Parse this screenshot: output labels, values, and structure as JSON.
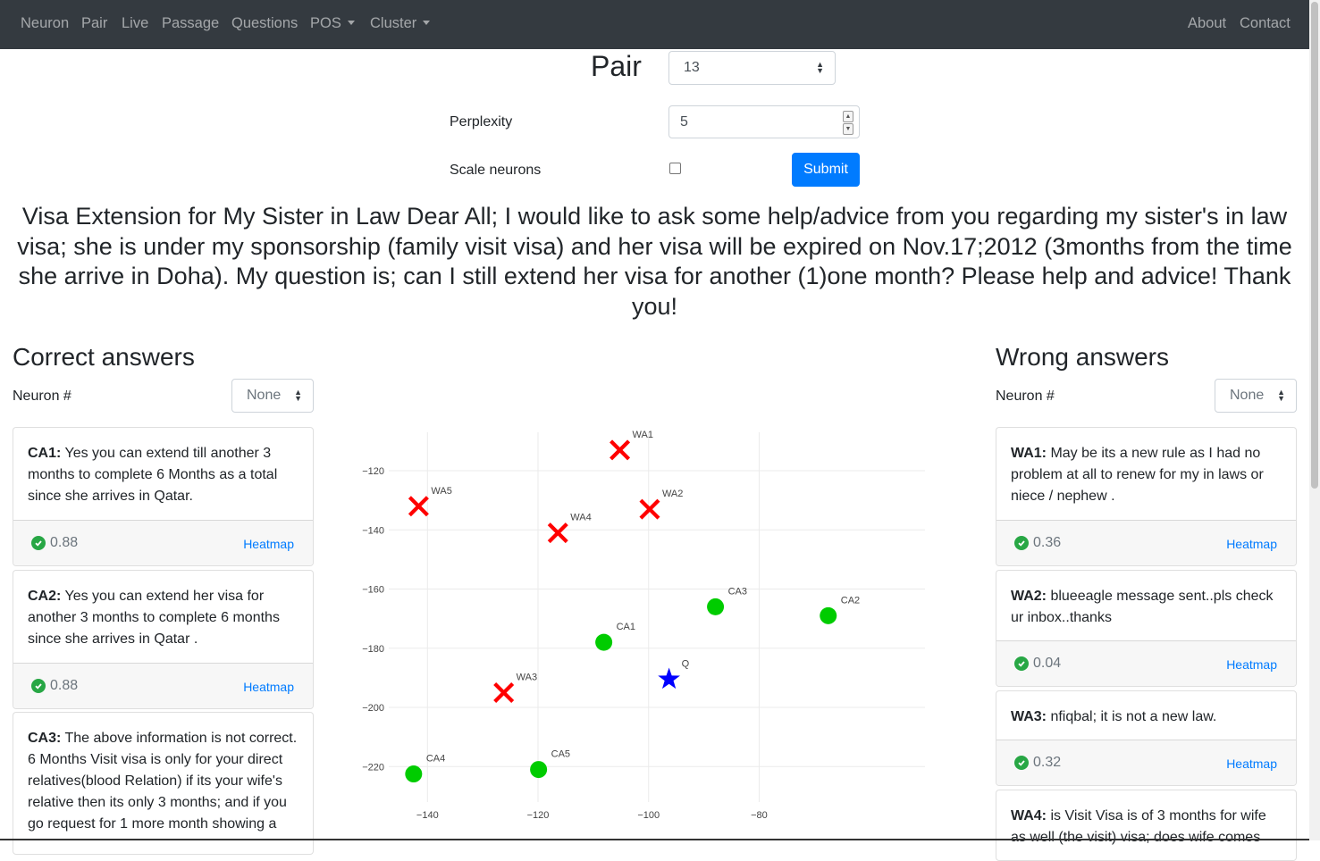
{
  "navbar": {
    "left_items": [
      {
        "label": "Neuron"
      },
      {
        "label": "Pair"
      },
      {
        "label": "Live"
      },
      {
        "label": "Passage"
      },
      {
        "label": "Questions"
      },
      {
        "label": "POS"
      },
      {
        "label": "Cluster"
      }
    ],
    "right_items": [
      {
        "label": "About"
      },
      {
        "label": "Contact"
      }
    ]
  },
  "form": {
    "pair_title": "Pair",
    "pair_value": "13",
    "perplexity_label": "Perplexity",
    "perplexity_value": "5",
    "scale_label": "Scale neurons",
    "scale_checked": false,
    "submit_label": "Submit"
  },
  "question_text": "Visa Extension for My Sister in Law Dear All; I would like to ask some help/advice from you regarding my sister's in law visa; she is under my sponsorship (family visit visa) and her visa will be expired on Nov.17;2012 (3months from the time she arrive in Doha). My question is; can I still extend her visa for another (1)one month? Please help and advice! Thank you!",
  "correct": {
    "title": "Correct answers",
    "neuron_label": "Neuron #",
    "neuron_value": "None",
    "cards": [
      {
        "id": "CA1:",
        "text": "Yes you can extend till another 3 months to complete 6 Months as a total since she arrives in Qatar.",
        "score": "0.88",
        "link": "Heatmap"
      },
      {
        "id": "CA2:",
        "text": "Yes you can extend her visa for another 3 months to complete 6 months since she arrives in Qatar .",
        "score": "0.88",
        "link": "Heatmap"
      },
      {
        "id": "CA3:",
        "text": "The above information is not correct. 6 Months Visit visa is only for your direct relatives(blood Relation) if its your wife's relative then its only 3 months; and if you go request for 1 more month showing a",
        "score": "",
        "link": ""
      }
    ]
  },
  "wrong": {
    "title": "Wrong answers",
    "neuron_label": "Neuron #",
    "neuron_value": "None",
    "cards": [
      {
        "id": "WA1:",
        "text": "May be its a new rule as I had no problem at all to renew for my in laws or niece / nephew .",
        "score": "0.36",
        "link": "Heatmap"
      },
      {
        "id": "WA2:",
        "text": "blueeagle message sent..pls check ur inbox..thanks",
        "score": "0.04",
        "link": "Heatmap"
      },
      {
        "id": "WA3:",
        "text": "nfiqbal; it is not a new law.",
        "score": "0.32",
        "link": "Heatmap"
      },
      {
        "id": "WA4:",
        "text": "is Visit Visa is of 3 months for wife as well (the visit) visa; does wife comes",
        "score": "",
        "link": ""
      }
    ]
  },
  "chart_data": {
    "type": "scatter",
    "xlim": [
      -147,
      -50
    ],
    "ylim": [
      -232,
      -107
    ],
    "x_ticks": [
      -140,
      -120,
      -100,
      -80
    ],
    "y_ticks": [
      -120,
      -140,
      -160,
      -180,
      -200,
      -220
    ],
    "grid": true,
    "series": [
      {
        "name": "",
        "marker": "circle",
        "color": "#00cc00",
        "points": [
          {
            "label": "CA1",
            "x": -108.1,
            "y": -178.0
          },
          {
            "label": "CA2",
            "x": -67.5,
            "y": -169.0
          },
          {
            "label": "CA3",
            "x": -87.9,
            "y": -166.0
          },
          {
            "label": "CA4",
            "x": -142.5,
            "y": -222.5
          },
          {
            "label": "CA5",
            "x": -119.9,
            "y": -221.0
          }
        ]
      },
      {
        "name": "",
        "marker": "x",
        "color": "#ff0000",
        "points": [
          {
            "label": "WA1",
            "x": -105.2,
            "y": -113.0
          },
          {
            "label": "WA2",
            "x": -99.8,
            "y": -133.0
          },
          {
            "label": "WA3",
            "x": -126.2,
            "y": -195.0
          },
          {
            "label": "WA4",
            "x": -116.4,
            "y": -141.0
          },
          {
            "label": "WA5",
            "x": -141.6,
            "y": -132.0
          }
        ]
      },
      {
        "name": "",
        "marker": "star",
        "color": "#0000ff",
        "points": [
          {
            "label": "Q",
            "x": -96.3,
            "y": -190.5
          }
        ]
      }
    ]
  }
}
